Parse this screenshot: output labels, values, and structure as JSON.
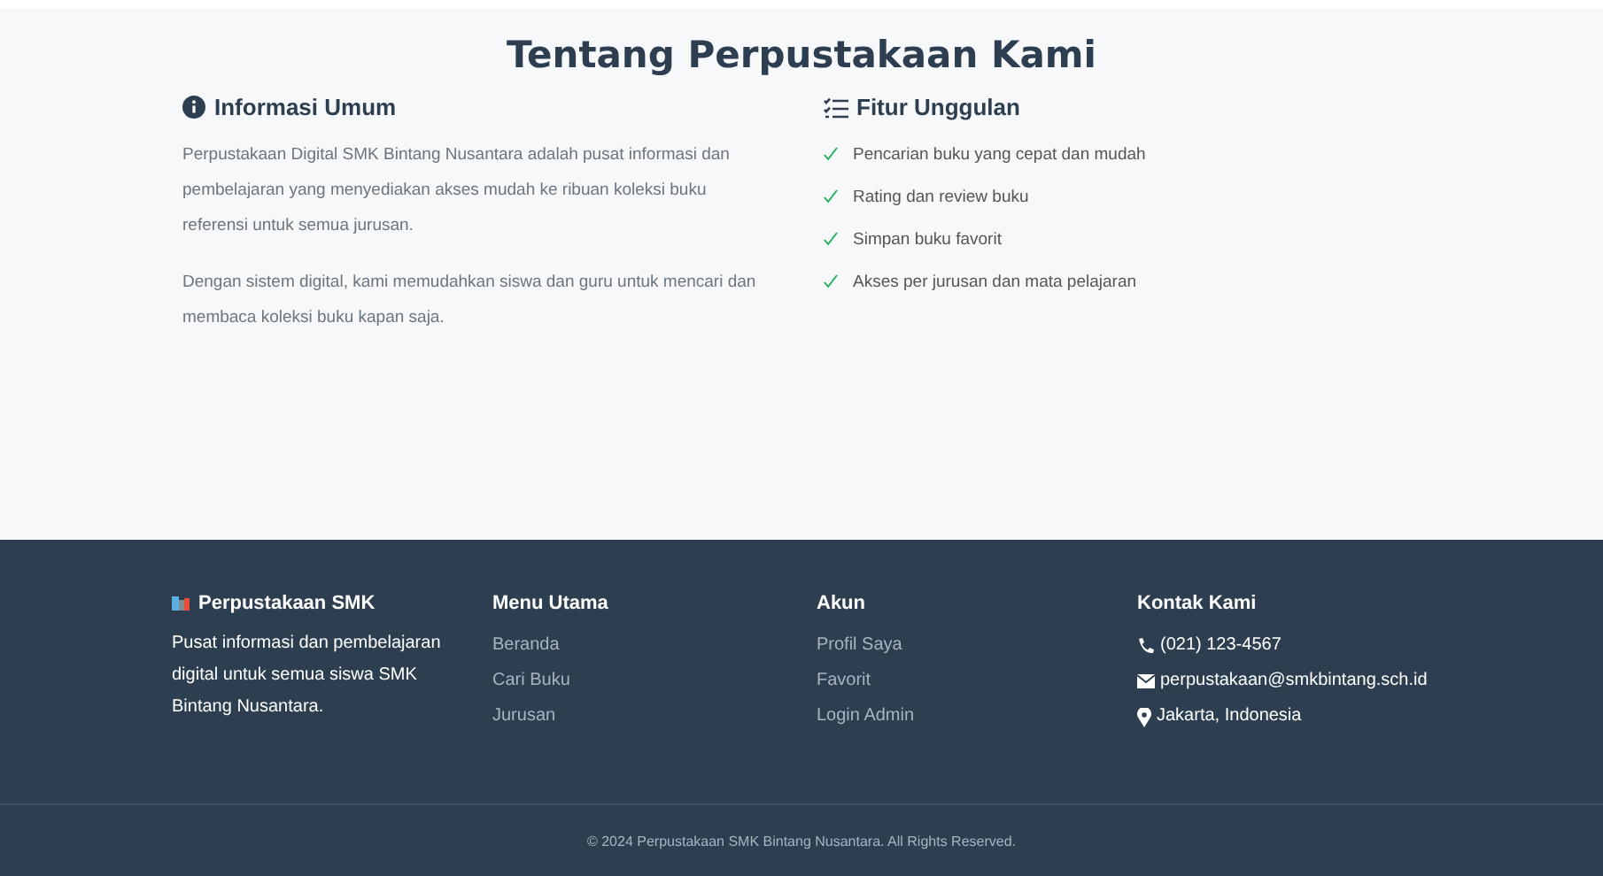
{
  "about": {
    "title": "Tentang Perpustakaan Kami",
    "info": {
      "heading": "Informasi Umum",
      "paragraphs": [
        "Perpustakaan Digital SMK Bintang Nusantara adalah pusat informasi dan pembelajaran yang menyediakan akses mudah ke ribuan koleksi buku referensi untuk semua jurusan.",
        "Dengan sistem digital, kami memudahkan siswa dan guru untuk mencari dan membaca koleksi buku kapan saja."
      ]
    },
    "features": {
      "heading": "Fitur Unggulan",
      "items": [
        "Pencarian buku yang cepat dan mudah",
        "Rating dan review buku",
        "Simpan buku favorit",
        "Akses per jurusan dan mata pelajaran"
      ]
    }
  },
  "footer": {
    "brand": {
      "title": "Perpustakaan SMK",
      "description": "Pusat informasi dan pembelajaran digital untuk semua siswa SMK Bintang Nusantara."
    },
    "columns": [
      {
        "heading": "Menu Utama",
        "links": [
          "Beranda",
          "Cari Buku",
          "Jurusan"
        ]
      },
      {
        "heading": "Akun",
        "links": [
          "Profil Saya",
          "Favorit",
          "Login Admin"
        ]
      }
    ],
    "contact": {
      "heading": "Kontak Kami",
      "items": [
        {
          "kind": "phone",
          "text": "(021) 123-4567"
        },
        {
          "kind": "email",
          "text": "perpustakaan@smkbintang.sch.id"
        },
        {
          "kind": "location",
          "text": "Jakarta, Indonesia"
        }
      ]
    },
    "copyright": "© 2024 Perpustakaan SMK Bintang Nusantara. All Rights Reserved."
  }
}
